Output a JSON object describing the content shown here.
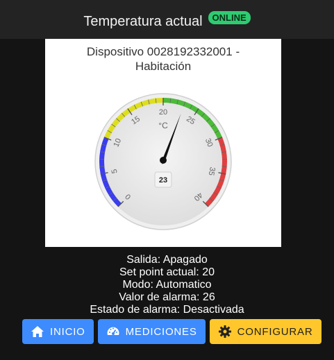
{
  "header": {
    "title": "Temperatura actual",
    "status_badge": "ONLINE"
  },
  "device": {
    "line1": "Dispositivo 0028192332001 -",
    "line2": "Habitación"
  },
  "gauge": {
    "unit": "°C",
    "value": 23,
    "value_label": "23",
    "ticks": [
      "0",
      "5",
      "10",
      "15",
      "20",
      "25",
      "30",
      "35",
      "40"
    ],
    "range": [
      0,
      40
    ],
    "colors": {
      "cold": "#3a3df0",
      "cool": "#dede20",
      "ok": "#4cbb3a",
      "hot": "#e04040"
    }
  },
  "info": {
    "salida": "Salida: Apagado",
    "setpoint": "Set point actual: 20",
    "modo": "Modo: Automatico",
    "alarma_valor": "Valor de alarma: 26",
    "alarma_estado": "Estado de alarma: Desactivada"
  },
  "buttons": {
    "inicio": "INICIO",
    "mediciones": "MEDICIONES",
    "configurar": "CONFIGURAR"
  },
  "icons": {
    "inicio": "home-icon",
    "mediciones": "gauge-icon",
    "configurar": "gear-icon"
  }
}
